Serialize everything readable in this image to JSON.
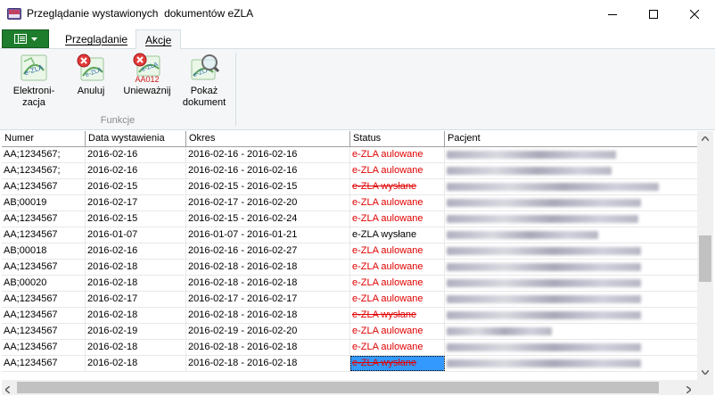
{
  "window": {
    "title": "Przeglądanie wystawionych  dokumentów eZLA"
  },
  "menu": {
    "tabs": [
      {
        "label": "Przeglądanie"
      },
      {
        "label": "Akcje"
      }
    ]
  },
  "ribbon": {
    "buttons": [
      {
        "label_1": "Elektroni-",
        "label_2": "zacja",
        "icon": "e-zla-icon"
      },
      {
        "label_1": "Anuluj",
        "label_2": "",
        "icon": "cancel-ezla-icon"
      },
      {
        "label_1": "Unieważnij",
        "label_2": "",
        "icon": "invalidate-ezla-icon",
        "icon_text": "AA012"
      },
      {
        "label_1": "Pokaż",
        "label_2": "dokument",
        "icon": "show-document-icon"
      }
    ],
    "group_label": "Funkcje"
  },
  "grid": {
    "columns": [
      "Numer",
      "Data wystawienia",
      "Okres",
      "Status",
      "Pacjent"
    ],
    "rows": [
      {
        "numer": "AA;1234567;",
        "data": "2016-02-16",
        "okres": "2016-02-16 - 2016-02-16",
        "status": "e-ZLA aulowane",
        "style": "red",
        "blur": 190
      },
      {
        "numer": "AA;1234567;",
        "data": "2016-02-16",
        "okres": "2016-02-16 - 2016-02-16",
        "status": "e-ZLA aulowane",
        "style": "red",
        "blur": 185
      },
      {
        "numer": "AA;1234567",
        "data": "2016-02-15",
        "okres": "2016-02-15 - 2016-02-15",
        "status": "e-ZLA wysłane",
        "style": "strike",
        "blur": 238
      },
      {
        "numer": "AB;00019",
        "data": "2016-02-17",
        "okres": "2016-02-17 - 2016-02-20",
        "status": "e-ZLA aulowane",
        "style": "red",
        "blur": 218
      },
      {
        "numer": "AA;1234567",
        "data": "2016-02-15",
        "okres": "2016-02-15 - 2016-02-24",
        "status": "e-ZLA aulowane",
        "style": "red",
        "blur": 215
      },
      {
        "numer": "AA;1234567",
        "data": "2016-01-07",
        "okres": "2016-01-07 - 2016-01-21",
        "status": "e-ZLA wysłane",
        "style": "black",
        "blur": 170
      },
      {
        "numer": "AB;00018",
        "data": "2016-02-16",
        "okres": "2016-02-16 - 2016-02-27",
        "status": "e-ZLA aulowane",
        "style": "red",
        "blur": 218
      },
      {
        "numer": "AA;1234567",
        "data": "2016-02-18",
        "okres": "2016-02-18 - 2016-02-18",
        "status": "e-ZLA aulowane",
        "style": "red",
        "blur": 218
      },
      {
        "numer": "AB;00020",
        "data": "2016-02-18",
        "okres": "2016-02-18 - 2016-02-18",
        "status": "e-ZLA aulowane",
        "style": "red",
        "blur": 218
      },
      {
        "numer": "AA;1234567",
        "data": "2016-02-17",
        "okres": "2016-02-17 - 2016-02-17",
        "status": "e-ZLA aulowane",
        "style": "red",
        "blur": 218
      },
      {
        "numer": "AA;1234567",
        "data": "2016-02-18",
        "okres": "2016-02-18 - 2016-02-18",
        "status": "e-ZLA wysłane",
        "style": "strike",
        "blur": 218
      },
      {
        "numer": "AA;1234567",
        "data": "2016-02-19",
        "okres": "2016-02-19 - 2016-02-20",
        "status": "e-ZLA aulowane",
        "style": "red",
        "blur": 118
      },
      {
        "numer": "AA;1234567",
        "data": "2016-02-18",
        "okres": "2016-02-18 - 2016-02-18",
        "status": "e-ZLA aulowane",
        "style": "red",
        "blur": 218
      },
      {
        "numer": "AA;1234567",
        "data": "2016-02-18",
        "okres": "2016-02-18 - 2016-02-18",
        "status": "e-ZLA wysłane",
        "style": "selected",
        "blur": 218
      }
    ]
  },
  "colors": {
    "status_red": "#e00000",
    "file_button": "#1e7d2c",
    "selection": "#3399ff"
  }
}
